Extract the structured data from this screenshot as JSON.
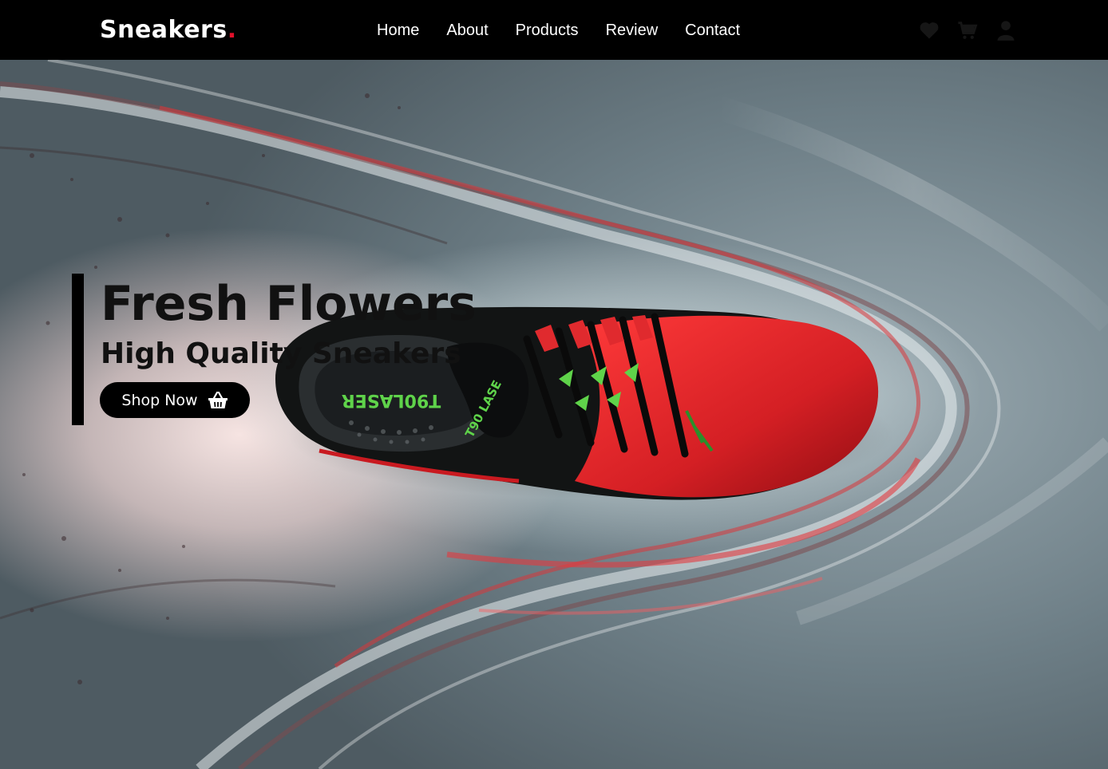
{
  "header": {
    "logo_text": "Sneakers",
    "logo_dot": ".",
    "nav": [
      {
        "label": "Home"
      },
      {
        "label": "About"
      },
      {
        "label": "Products"
      },
      {
        "label": "Review"
      },
      {
        "label": "Contact"
      }
    ],
    "icons": [
      "heart-icon",
      "cart-icon",
      "user-icon"
    ]
  },
  "hero": {
    "title": "Fresh Flowers",
    "subtitle": "High Quality Sneakers",
    "cta_label": "Shop Now",
    "cta_icon": "basket-icon",
    "shoe_print": {
      "insole_text": "T90LASER",
      "side_text": "T90 LASE"
    }
  },
  "colors": {
    "header_bg": "#000000",
    "accent_red": "#e0102a",
    "text_dark": "#111111",
    "shoe_red": "#d41f24",
    "shoe_green": "#5fd34a"
  }
}
